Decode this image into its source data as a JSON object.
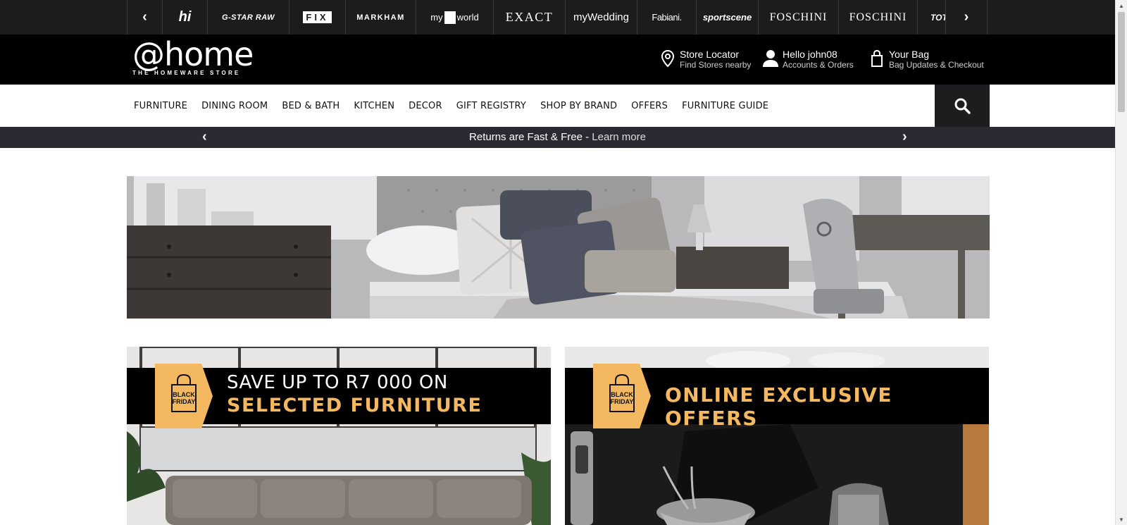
{
  "brand_strip": {
    "prev_arrow": "‹",
    "next_arrow": "›",
    "brands": [
      "hi",
      "G-STAR RAW",
      "FIX",
      "MARKHAM",
      "my",
      "world",
      "EXACT",
      "myWedding",
      "Fabiani.",
      "sportscene",
      "FOSCHINI",
      "FOSCHINI",
      "TOTA"
    ]
  },
  "header": {
    "logo_main": "@home",
    "logo_tag": "THE HOMEWARE STORE",
    "store_locator": {
      "title": "Store Locator",
      "subtitle": "Find Stores nearby"
    },
    "account": {
      "title": "Hello john08",
      "subtitle": "Accounts & Orders"
    },
    "bag": {
      "title": "Your Bag",
      "subtitle": "Bag Updates & Checkout"
    }
  },
  "nav": {
    "items": [
      "FURNITURE",
      "DINING ROOM",
      "BED & BATH",
      "KITCHEN",
      "DECOR",
      "GIFT REGISTRY",
      "SHOP BY BRAND",
      "OFFERS",
      "FURNITURE GUIDE"
    ]
  },
  "promo": {
    "text": "Returns are Fast & Free",
    "separator": " - ",
    "link": "Learn more",
    "prev_arrow": "‹",
    "next_arrow": "›"
  },
  "cards": {
    "left": {
      "badge_line1": "BLACK",
      "badge_line2": "FRIDAY",
      "line1": "SAVE UP TO R7 000 ON",
      "line2": "SELECTED FURNITURE"
    },
    "right": {
      "badge_line1": "BLACK",
      "badge_line2": "FRIDAY",
      "line1": "ONLINE EXCLUSIVE OFFERS"
    }
  },
  "colors": {
    "accent": "#f4b860",
    "header_bg": "#000000",
    "promo_bg": "#2a2a33"
  }
}
